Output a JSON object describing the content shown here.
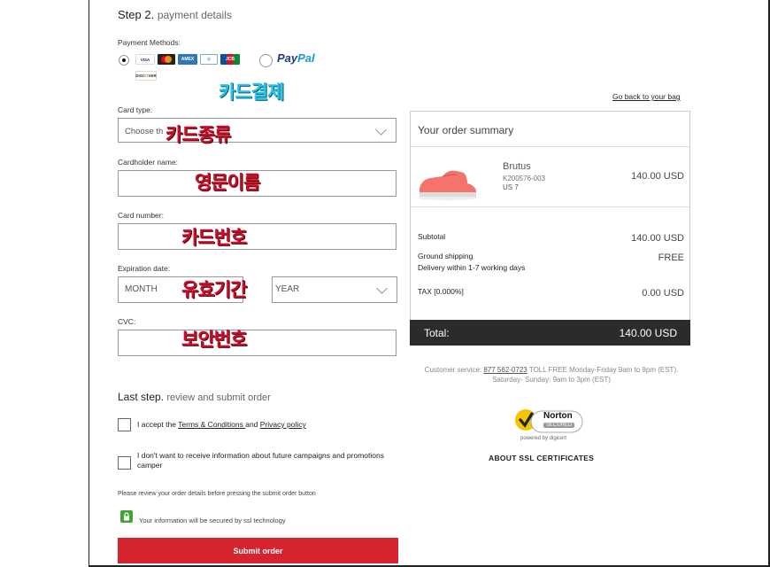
{
  "step2": {
    "title": "Step 2.",
    "subtitle": "payment details"
  },
  "payment": {
    "methods_label": "Payment Methods:",
    "cards": [
      "Verified by VISA",
      "Mastercard",
      "AMEX",
      "Diners",
      "JCB",
      "DISCOVER"
    ],
    "paypal_1": "Pay",
    "paypal_2": "Pal"
  },
  "annotations": {
    "card_payment": "카드결제",
    "card_type": "카드종류",
    "english_name": "영문이름",
    "card_number": "카드번호",
    "expiry": "유효기간",
    "security_code": "보안번호"
  },
  "form": {
    "card_type_label": "Card type:",
    "card_type_placeholder": "Choose th",
    "cardholder_label": "Cardholder name:",
    "card_number_label": "Card number:",
    "expiration_label": "Expiration date:",
    "month_placeholder": "MONTH",
    "year_placeholder": "YEAR",
    "cvc_label": "CVC:"
  },
  "last_step": {
    "title": "Last step.",
    "subtitle": "review and submit order",
    "accept_prefix": "I accept the ",
    "terms": "Terms & Conditions ",
    "and": "and ",
    "privacy": "Privacy policy",
    "no_info": "I don't want to receive information about future campaigns and promotions camper",
    "review_note": "Please review your order details before pressing the submit order button",
    "ssl_note": "Your information will be secured by ssl technology",
    "submit": "Submit order"
  },
  "summary": {
    "back_link": "Go back to your bag",
    "title": "Your order summary",
    "product_name": "Brutus",
    "product_code": "K200576-003",
    "product_size": "US 7",
    "product_price": "140.00 USD",
    "subtotal_label": "Subtotal",
    "subtotal_value": "140.00 USD",
    "shipping_label": "Ground shipping",
    "shipping_detail": "Delivery  within 1-7 working days",
    "shipping_value": "FREE",
    "tax_label": "TAX [0.000%]",
    "tax_value": "0.00 USD",
    "total_label": "Total:",
    "total_value": "140.00  USD"
  },
  "service": {
    "prefix": "Customer service: ",
    "phone": "877 562-0723",
    "hours": " TOLL FREE Monday-Friday 9am to 9pm (EST). Saturday- Sunday: 9am to 3pm (EST)"
  },
  "norton": {
    "brand": "Norton",
    "secured": "SECURED",
    "powered": "powered by digicert",
    "about_ssl": "ABOUT SSL CERTIFICATES"
  },
  "colors": {
    "accent_red": "#d6242e",
    "total_bar": "#2b2b2b",
    "shoe": "#f4736a",
    "norton_yellow": "#f5c400"
  }
}
